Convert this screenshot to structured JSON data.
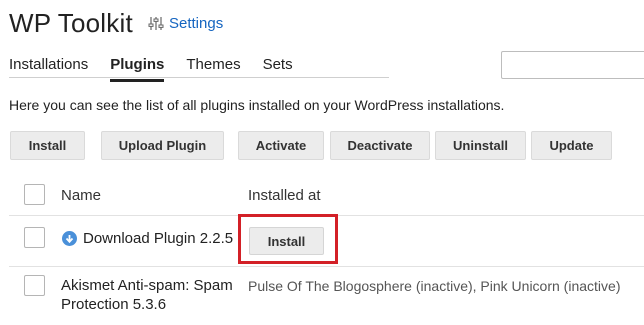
{
  "header": {
    "title": "WP Toolkit",
    "settings_label": "Settings"
  },
  "tabs": [
    {
      "label": "Installations"
    },
    {
      "label": "Plugins"
    },
    {
      "label": "Themes"
    },
    {
      "label": "Sets"
    }
  ],
  "description": "Here you can see the list of all plugins installed on your WordPress installations.",
  "toolbar": {
    "install": "Install",
    "upload_plugin": "Upload Plugin",
    "activate": "Activate",
    "deactivate": "Deactivate",
    "uninstall": "Uninstall",
    "update": "Update"
  },
  "table": {
    "headers": {
      "name": "Name",
      "installed_at": "Installed at"
    },
    "rows": [
      {
        "name": "Download Plugin 2.2.5",
        "action_label": "Install",
        "icon": "download-circle-icon"
      },
      {
        "name_line1": "Akismet Anti-spam: Spam",
        "name_line2": "Protection 5.3.6",
        "site1": "Pulse Of The Blogosphere",
        "site1_status": " (inactive), ",
        "site2": "Pink Unicorn",
        "site2_status": " (inactive)"
      }
    ]
  },
  "colors": {
    "link": "#1565c0",
    "highlight": "#d32027",
    "download_icon": "#4a90d9"
  }
}
